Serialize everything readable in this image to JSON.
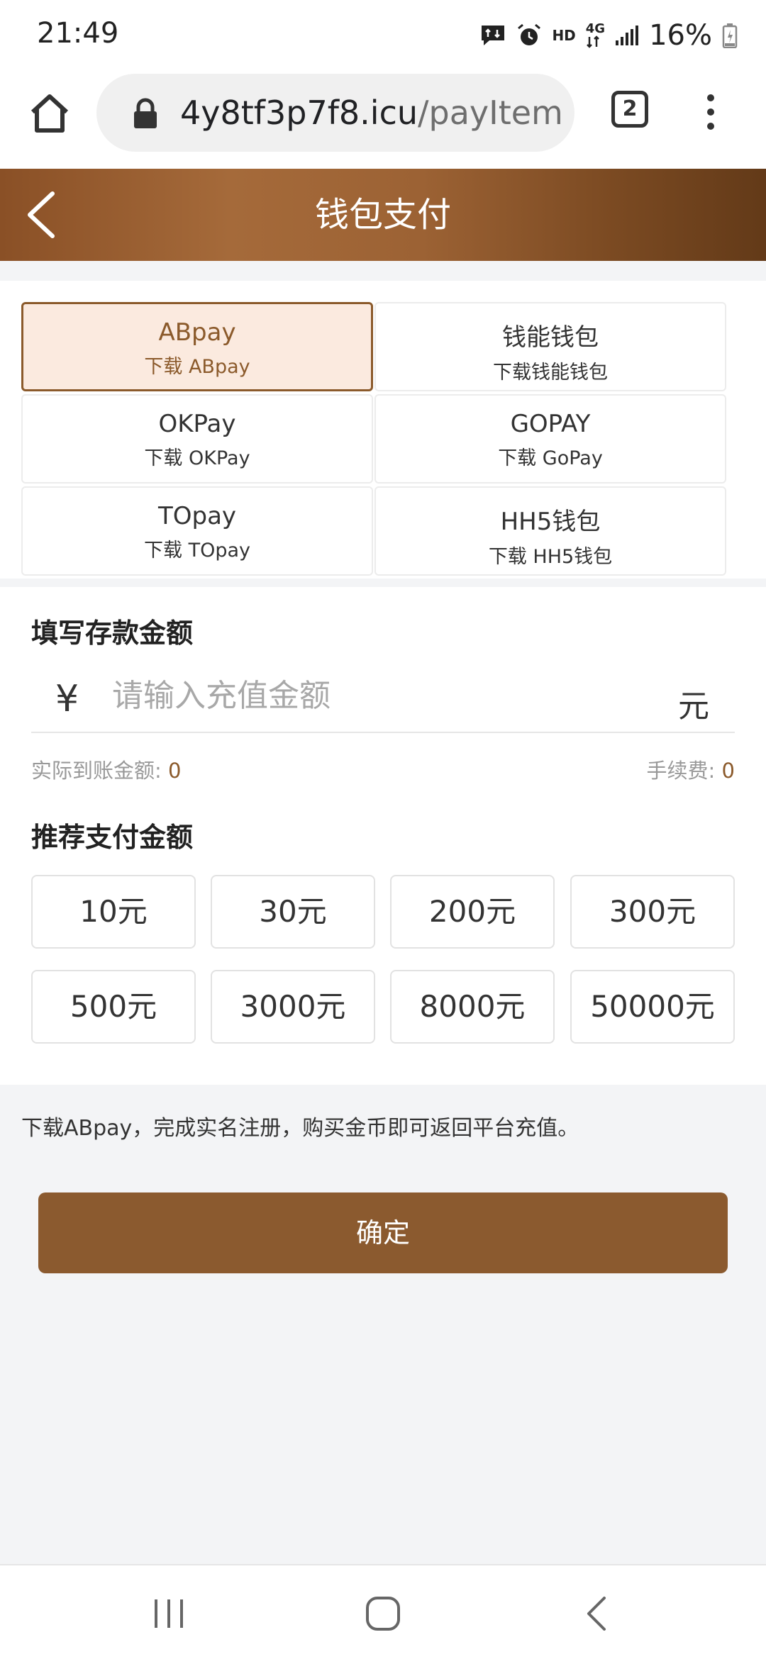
{
  "status": {
    "time": "21:49",
    "hd": "HD",
    "network": "4G",
    "battery": "16%",
    "icons": [
      "message-icon",
      "alarm-icon",
      "signal-icon",
      "battery-icon"
    ]
  },
  "browser": {
    "url_domain": "4y8tf3p7f8.icu",
    "url_path": "/payItem",
    "tab_count": "2",
    "icons": [
      "home-icon",
      "lock-icon",
      "tabs-icon",
      "menu-icon"
    ]
  },
  "header": {
    "title": "钱包支付"
  },
  "wallets": [
    {
      "name": "ABpay",
      "sub": "下载 ABpay",
      "selected": true
    },
    {
      "name": "钱能钱包",
      "sub": "下载钱能钱包",
      "selected": false
    },
    {
      "name": "OKPay",
      "sub": "下载 OKPay",
      "selected": false
    },
    {
      "name": "GOPAY",
      "sub": "下载 GoPay",
      "selected": false
    },
    {
      "name": "TOpay",
      "sub": "下载 TOpay",
      "selected": false
    },
    {
      "name": "HH5钱包",
      "sub": "下载 HH5钱包",
      "selected": false
    }
  ],
  "deposit": {
    "title": "填写存款金额",
    "currency_symbol": "¥",
    "placeholder": "请输入充值金额",
    "unit": "元",
    "actual_label": "实际到账金额: ",
    "actual_value": "0",
    "fee_label": "手续费: ",
    "fee_value": "0"
  },
  "recommend": {
    "title": "推荐支付金额",
    "amounts": [
      "10元",
      "30元",
      "200元",
      "300元",
      "500元",
      "3000元",
      "8000元",
      "50000元"
    ]
  },
  "note": "下载ABpay，完成实名注册，购买金币即可返回平台充值。",
  "confirm_label": "确定",
  "colors": {
    "brand": "#8b5a2f",
    "selected_bg": "#fbeadf",
    "background": "#f3f4f6"
  }
}
